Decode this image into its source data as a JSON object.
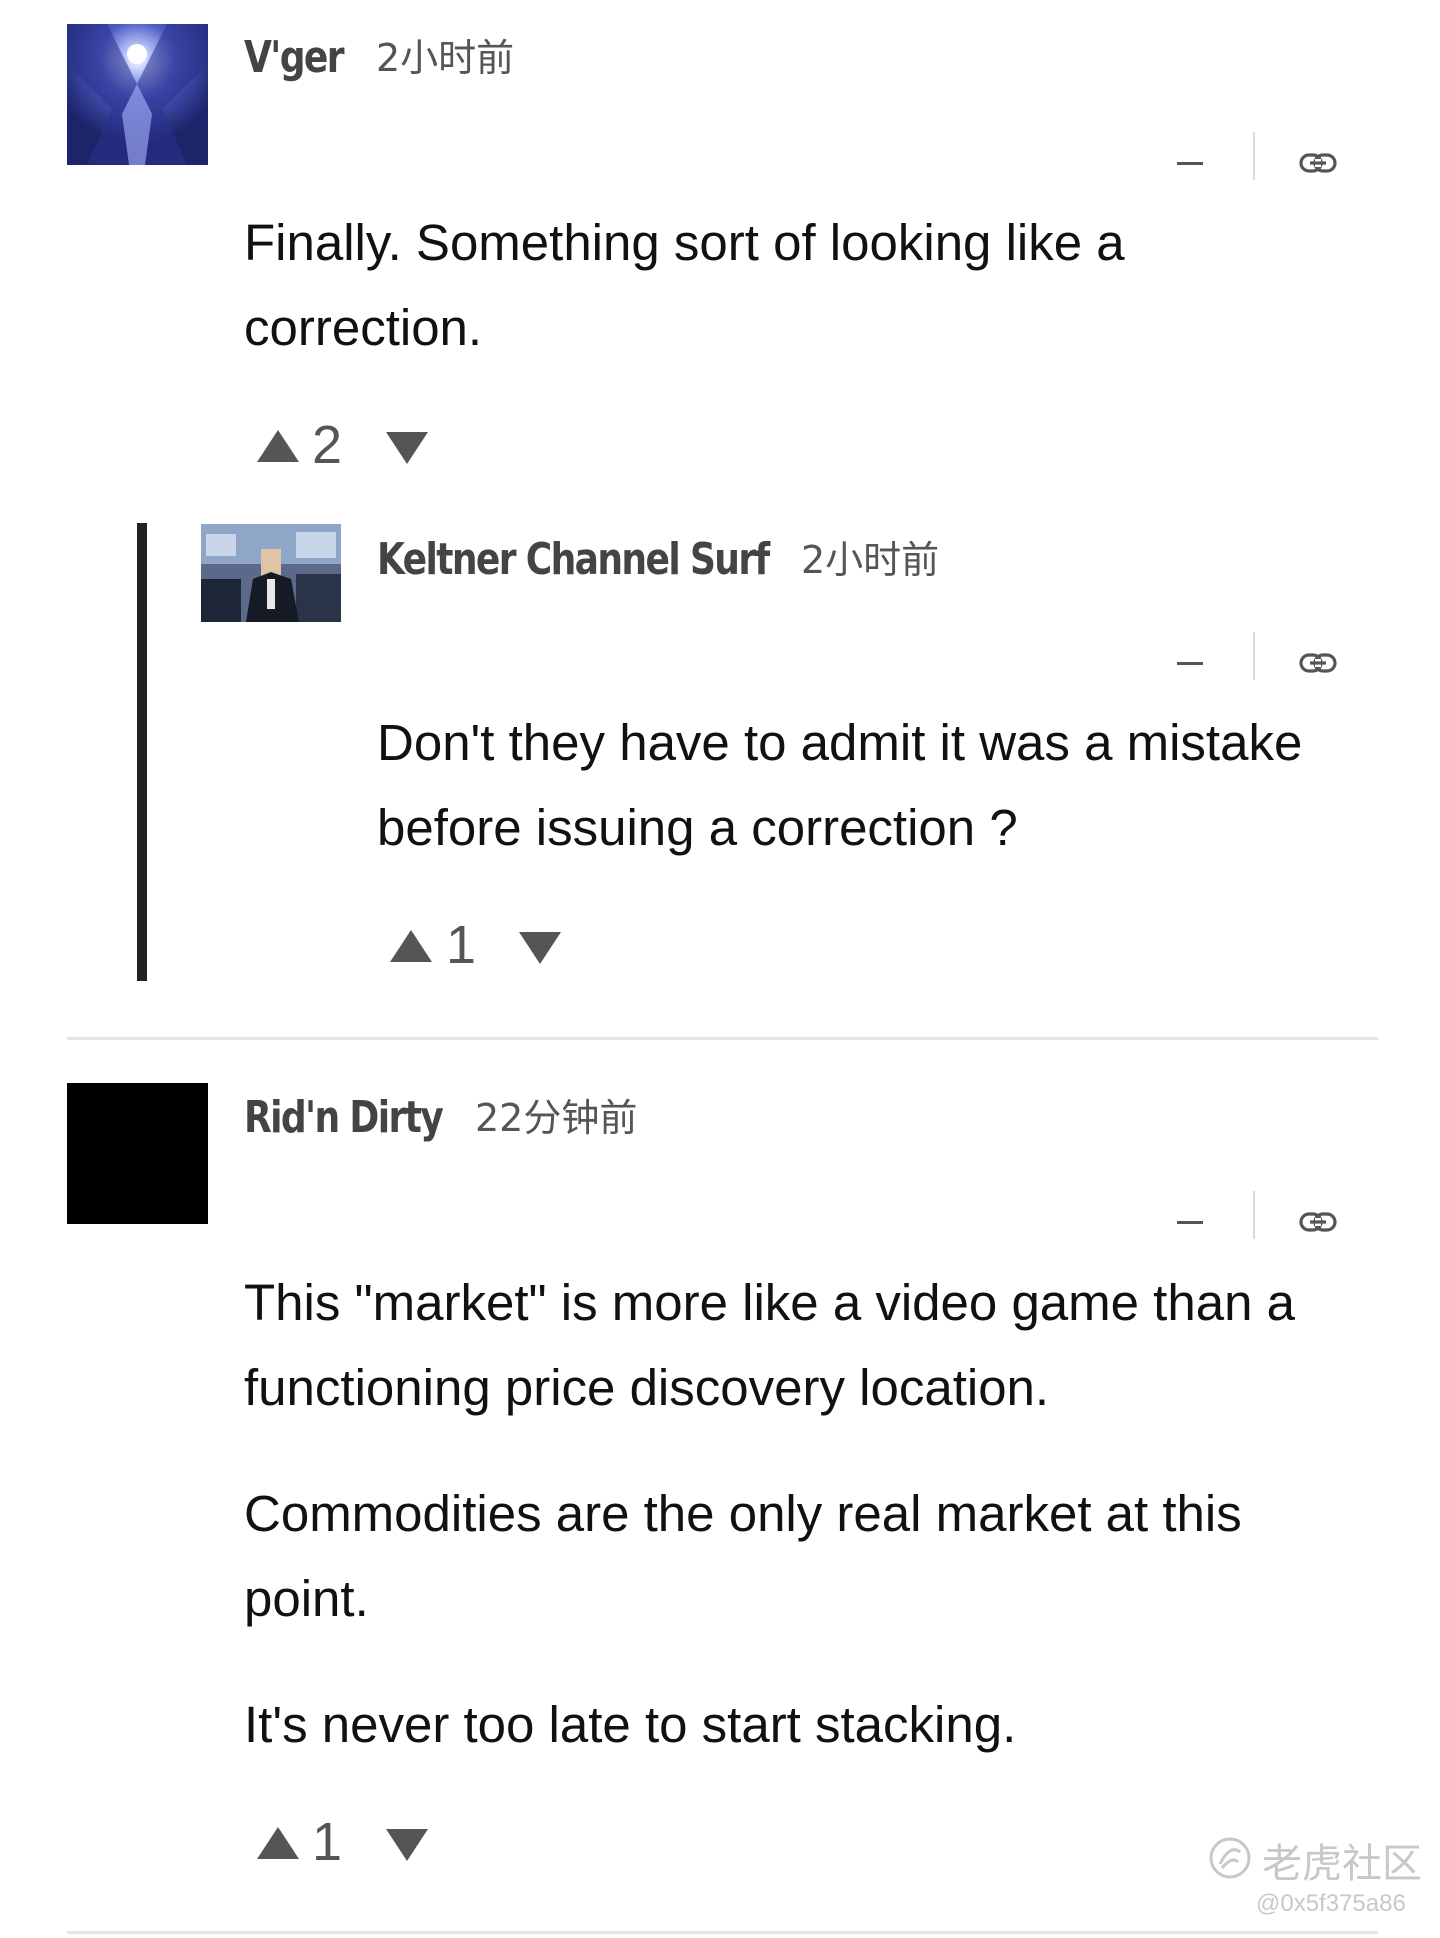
{
  "comments": [
    {
      "author": "V'ger",
      "time": "2小时前",
      "paragraphs": [
        "Finally. Something sort of looking like a correction."
      ],
      "votes": "2",
      "avatar_icon": "astronaut-avatar-icon"
    },
    {
      "author": "Keltner Channel Surf",
      "time": "2小时前",
      "paragraphs": [
        "Don't they have to admit it was a mistake before issuing a correction ?"
      ],
      "votes": "1",
      "avatar_icon": "trader-avatar-icon",
      "is_reply": true
    },
    {
      "author": "Rid'n Dirty",
      "time": "22分钟前",
      "paragraphs": [
        "This \"market\" is more like a video game than a functioning price discovery location.",
        "Commodities are the only real market at this point.",
        "It's never too late to start stacking."
      ],
      "votes": "1",
      "avatar_icon": "black-avatar-icon"
    }
  ],
  "actions": {
    "collapse_icon": "minus-icon",
    "link_icon": "link-icon",
    "upvote_icon": "triangle-up-icon",
    "downvote_icon": "triangle-down-icon"
  },
  "watermark": {
    "logo_text": "老虎社区",
    "handle": "@0x5f375a86"
  },
  "colors": {
    "text": "#111111",
    "meta": "#555555",
    "thread_bar": "#222222",
    "divider": "#e4e4e4"
  }
}
